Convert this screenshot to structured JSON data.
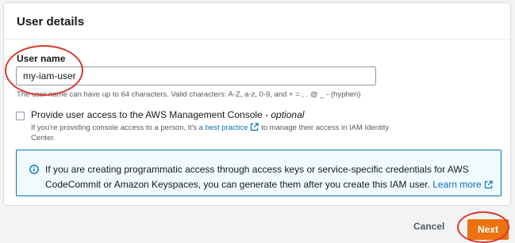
{
  "panel": {
    "title": "User details"
  },
  "username": {
    "label": "User name",
    "value": "my-iam-user",
    "hint": "The user name can have up to 64 characters. Valid characters: A-Z, a-z, 0-9, and + = , . @ _ - (hyphen)"
  },
  "console_access": {
    "label": "Provide user access to the AWS Management Console",
    "optional": " - optional",
    "desc_before": "If you're providing console access to a person, it's a ",
    "desc_link": "best practice",
    "desc_after": " to manage their access in IAM Identity Center."
  },
  "info": {
    "text": "If you are creating programmatic access through access keys or service-specific credentials for AWS CodeCommit or Amazon Keyspaces, you can generate them after you create this IAM user. ",
    "link": "Learn more"
  },
  "actions": {
    "cancel": "Cancel",
    "next": "Next"
  },
  "colors": {
    "accent": "#ec7211",
    "link": "#0073bb",
    "annotation": "#d9382d"
  },
  "icons": [
    "external-link-icon",
    "info-icon"
  ]
}
